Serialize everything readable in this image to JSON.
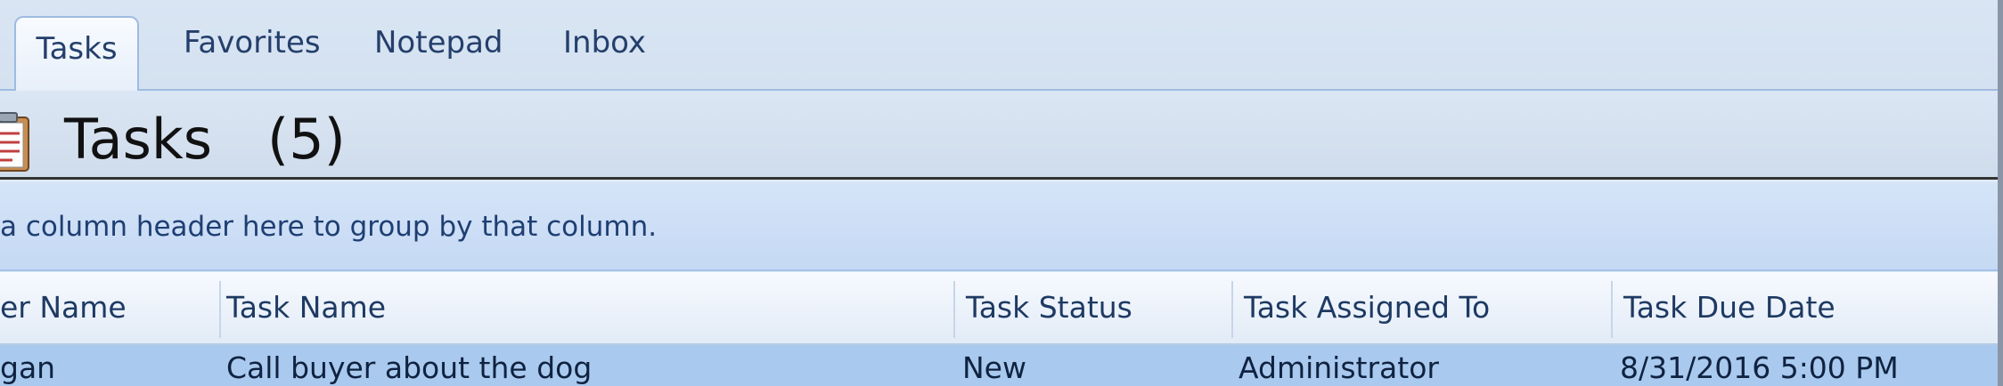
{
  "tabs": [
    {
      "label": "Tasks",
      "active": true
    },
    {
      "label": "Favorites",
      "active": false
    },
    {
      "label": "Notepad",
      "active": false
    },
    {
      "label": "Inbox",
      "active": false
    }
  ],
  "header": {
    "title": "Tasks",
    "count": "(5)",
    "icon": "clipboard-icon"
  },
  "group_panel": {
    "hint": "a column header here to group by that column."
  },
  "columns": [
    "er Name",
    "Task Name",
    "Task Status",
    "Task Assigned To",
    "Task Due Date"
  ],
  "rows": [
    {
      "customer_name": "gan",
      "task_name": "Call buyer about the dog",
      "task_status": "New",
      "task_assigned_to": "Administrator",
      "task_due_date": "8/31/2016 5:00 PM"
    }
  ],
  "colors": {
    "selected_row": "#a9c9ee",
    "header_text": "#1e3a63"
  }
}
